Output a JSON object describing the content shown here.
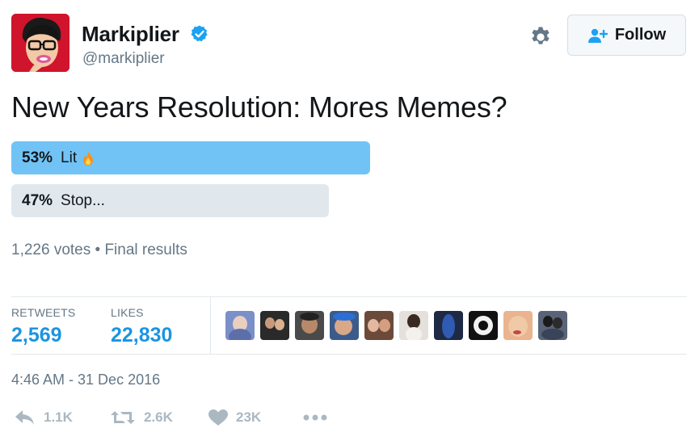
{
  "user": {
    "name": "Markiplier",
    "handle": "@markiplier"
  },
  "follow": {
    "label": "Follow"
  },
  "tweet": {
    "text": "New Years Resolution: Mores Memes?"
  },
  "poll": {
    "options": [
      {
        "percent": "53%",
        "label": "Lit",
        "share": 0.53,
        "emoji": "fire-icon"
      },
      {
        "percent": "47%",
        "label": "Stop...",
        "share": 0.47
      }
    ],
    "meta": "1,226 votes • Final results"
  },
  "stats": {
    "retweets_label": "RETWEETS",
    "retweets_value": "2,569",
    "likes_label": "LIKES",
    "likes_value": "22,830"
  },
  "liker_avatars": [
    "liker-avatar-1",
    "liker-avatar-2",
    "liker-avatar-3",
    "liker-avatar-4",
    "liker-avatar-5",
    "liker-avatar-6",
    "liker-avatar-7",
    "liker-avatar-8",
    "liker-avatar-9"
  ],
  "timestamp": "4:46 AM - 31 Dec 2016",
  "actions": {
    "reply_count": "1.1K",
    "retweet_count": "2.6K",
    "like_count": "23K"
  },
  "colors": {
    "accent": "#1b95e0",
    "poll_winner": "#71c3f5",
    "poll_other": "#e1e8ed",
    "muted": "#657786",
    "action_grey": "#aab8c2"
  }
}
